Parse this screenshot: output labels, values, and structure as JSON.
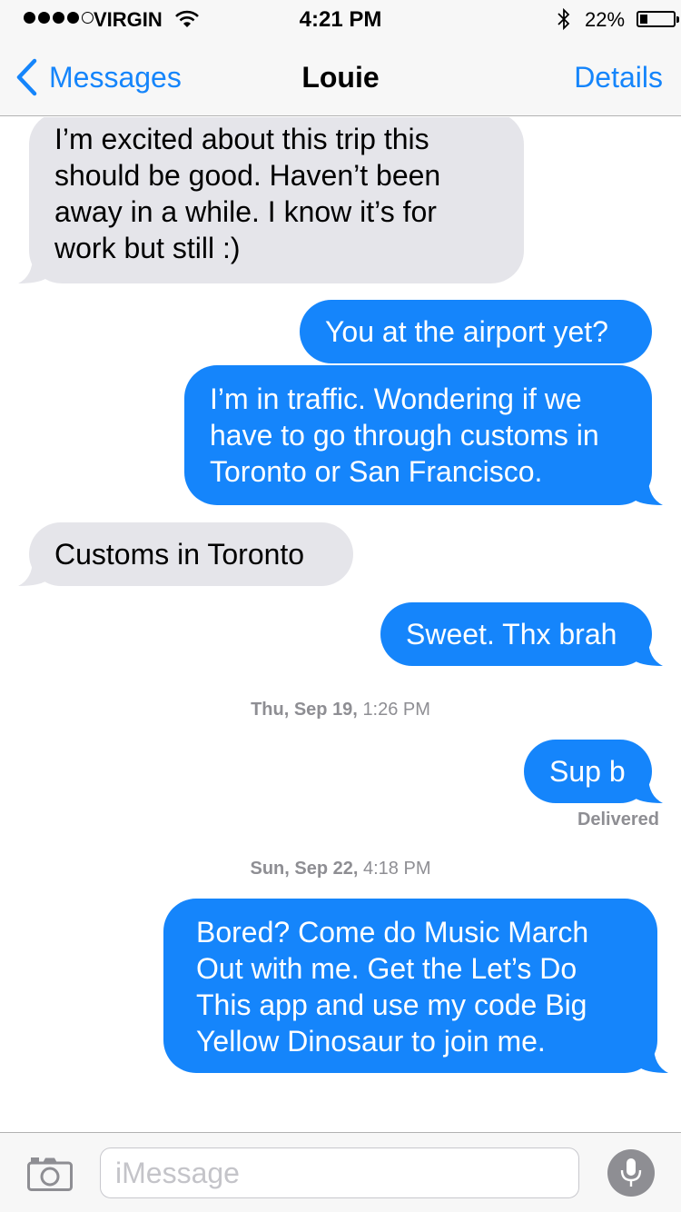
{
  "status_bar": {
    "carrier": "VIRGIN",
    "time": "4:21 PM",
    "battery_percent": "22%",
    "battery_level": 0.22,
    "signal_bars_filled": 4,
    "signal_bars_total": 5,
    "icons": [
      "wifi-icon",
      "bluetooth-icon",
      "battery-icon"
    ]
  },
  "nav": {
    "back_label": "Messages",
    "title": "Louie",
    "details_label": "Details",
    "accent_color": "#1585fb"
  },
  "conversation": {
    "incoming_color": "#e5e5ea",
    "outgoing_color": "#1585fb",
    "messages": [
      {
        "direction": "incoming",
        "lines": [
          "I’m excited about this trip this",
          "should be good. Haven’t been",
          "away in a while. I know it’s for",
          "work but still :)"
        ]
      },
      {
        "direction": "outgoing",
        "lines": [
          "You at the airport yet?"
        ]
      },
      {
        "direction": "outgoing",
        "lines": [
          "I’m in traffic. Wondering if we",
          "have to go through customs in",
          "Toronto or San Francisco."
        ]
      },
      {
        "direction": "incoming",
        "lines": [
          "Customs in Toronto"
        ]
      },
      {
        "direction": "outgoing",
        "lines": [
          "Sweet. Thx brah"
        ]
      },
      {
        "direction": "outgoing",
        "lines": [
          "Sup b"
        ]
      },
      {
        "direction": "outgoing",
        "lines": [
          "Bored? Come do Music March",
          "Out with me. Get the Let’s Do",
          "This app and use my code Big",
          "Yellow Dinosaur to join me."
        ]
      }
    ],
    "timestamps": [
      {
        "date": "Thu, Sep 19,",
        "time": "1:26 PM"
      },
      {
        "date": "Sun, Sep 22,",
        "time": "4:18 PM"
      }
    ],
    "delivered_label": "Delivered"
  },
  "input": {
    "placeholder": "iMessage",
    "value": "",
    "icons": [
      "camera-icon",
      "microphone-icon"
    ]
  }
}
